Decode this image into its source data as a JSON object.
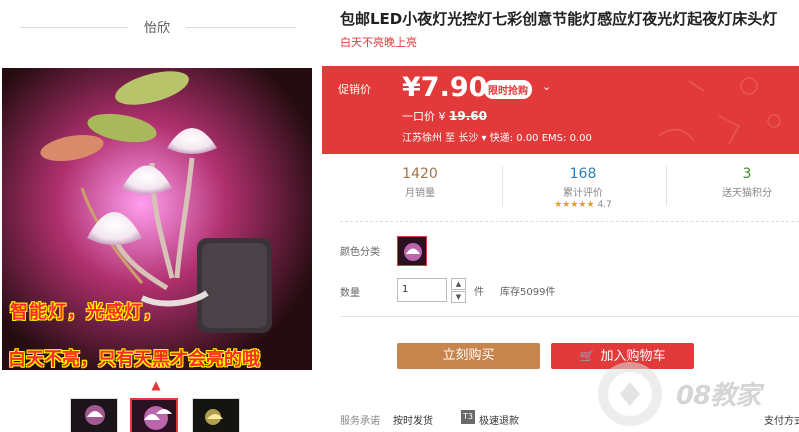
{
  "shop": {
    "name": "怡欣"
  },
  "image": {
    "caption_line1": "智能灯，光感灯，",
    "caption_line2": "白天不亮，只有天黑才会亮的哦"
  },
  "product": {
    "title": "包邮LED小夜灯光控灯七彩创意节能灯感应灯夜光灯起夜灯床头灯",
    "subtitle": "白天不亮晚上亮"
  },
  "price": {
    "label": "促销价",
    "current": "¥7.90",
    "badge": "限时抢购",
    "badge_arrow": "⌄",
    "original_label": "一口价 ¥",
    "original_value": "19.60",
    "shipping": "江苏徐州 至   长沙 ▾  快递: 0.00 EMS: 0.00"
  },
  "stats": {
    "monthly_sales": {
      "value": "1420",
      "label": "月销量"
    },
    "reviews": {
      "value": "168",
      "label": "累计评价",
      "stars": "★★★★★",
      "score": "4.7"
    },
    "points": {
      "value": "3",
      "label": "送天猫积分"
    }
  },
  "options": {
    "color_label": "颜色分类",
    "qty_label": "数量",
    "qty_value": "1",
    "qty_up": "▲",
    "qty_down": "▼",
    "unit": "件",
    "stock": "库存5099件"
  },
  "actions": {
    "buy_now": "立刻购买",
    "add_to_cart": "加入购物车",
    "cart_icon": "🛒"
  },
  "service": {
    "label": "服务承诺",
    "item1": "按时发货",
    "t3_badge": "T3",
    "item2": "极速退款",
    "item3": "支付方式"
  },
  "watermark": {
    "text": "08教家"
  },
  "colors": {
    "accent": "#e23a3a",
    "buy": "#c7844d"
  }
}
